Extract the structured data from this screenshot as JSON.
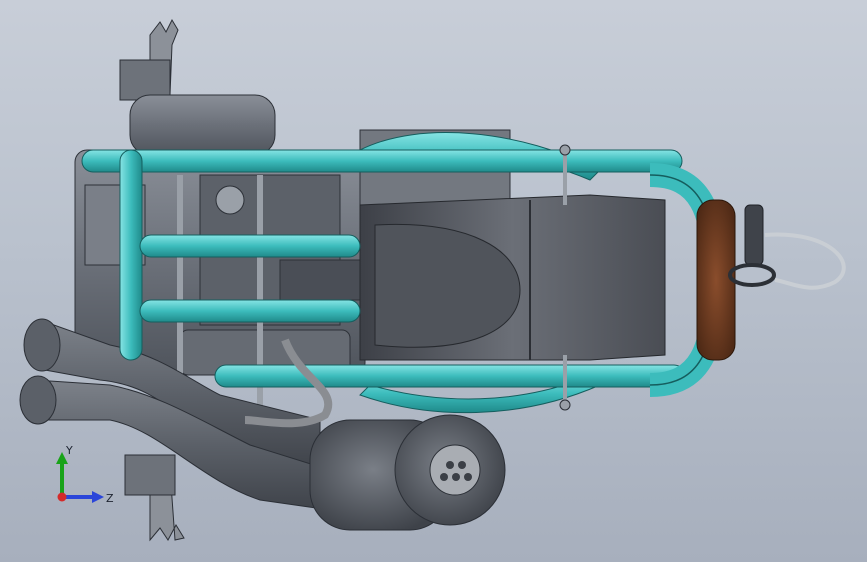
{
  "viewport": {
    "background_top": "#c8ced8",
    "background_bottom": "#a7afbd"
  },
  "model": {
    "frame_color": "#3cbcbc",
    "engine_color": "#6e737c",
    "exhaust_color": "#5a5f66",
    "filter_color": "#6a3a22"
  },
  "triad": {
    "y_label": "Y",
    "z_label": "Z",
    "y_color": "#19a319",
    "z_color": "#2a45d9",
    "x_color": "#d42a2a"
  }
}
